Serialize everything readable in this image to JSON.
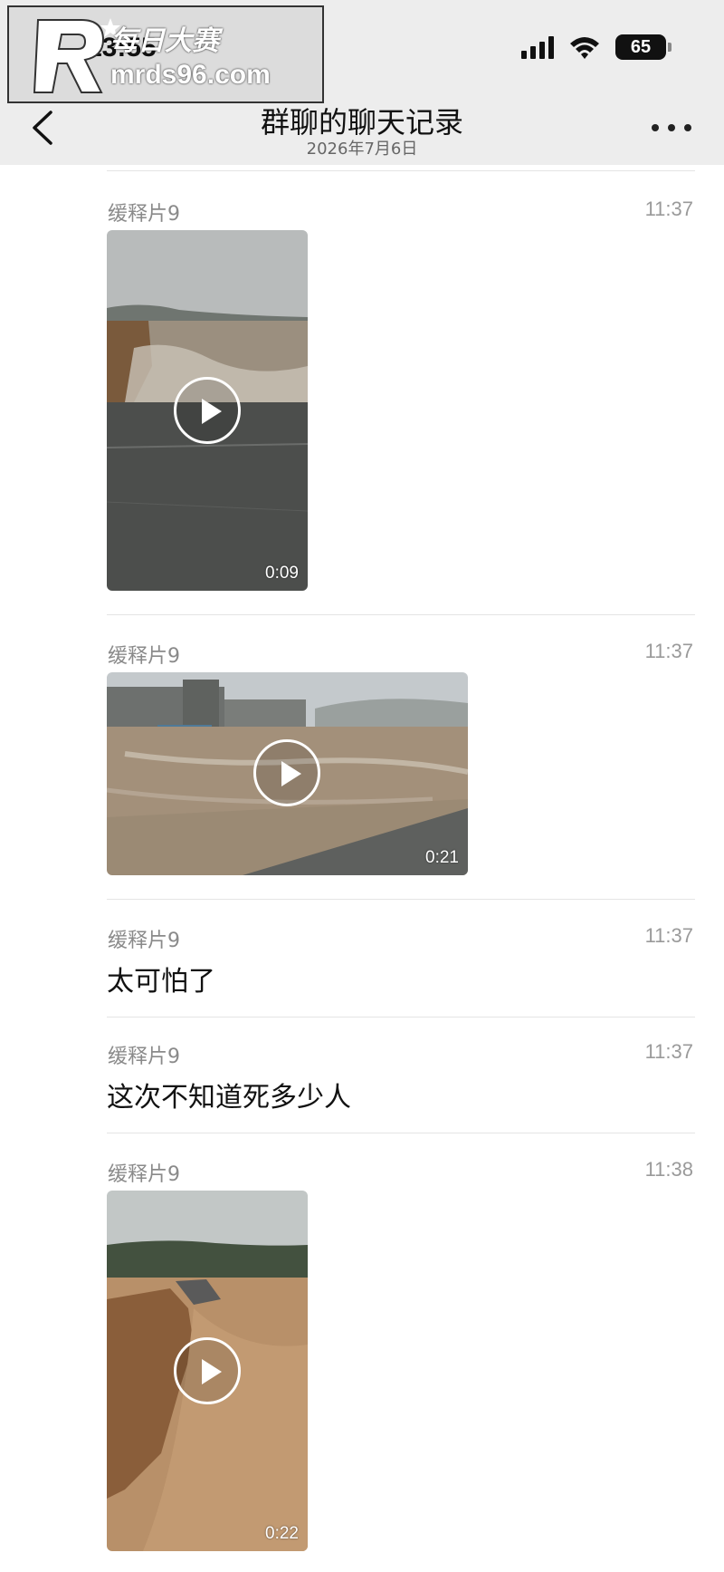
{
  "status_bar": {
    "time": "13:55",
    "battery": "65"
  },
  "watermark": {
    "brand_cn": "每日大赛",
    "url": "mrds96.com"
  },
  "header": {
    "title": "群聊的聊天记录",
    "date": "2026年7月6日"
  },
  "messages": [
    {
      "sender": "缓释片9",
      "time": "11:37",
      "type": "video",
      "duration": "0:09"
    },
    {
      "sender": "缓释片9",
      "time": "11:37",
      "type": "video",
      "duration": "0:21"
    },
    {
      "sender": "缓释片9",
      "time": "11:37",
      "type": "text",
      "text": "太可怕了"
    },
    {
      "sender": "缓释片9",
      "time": "11:37",
      "type": "text",
      "text": "这次不知道死多少人"
    },
    {
      "sender": "缓释片9",
      "time": "11:38",
      "type": "video",
      "duration": "0:22"
    }
  ],
  "icons": [
    "back-chevron-icon",
    "more-dots-icon",
    "signal-icon",
    "wifi-icon",
    "battery-icon",
    "play-icon"
  ]
}
